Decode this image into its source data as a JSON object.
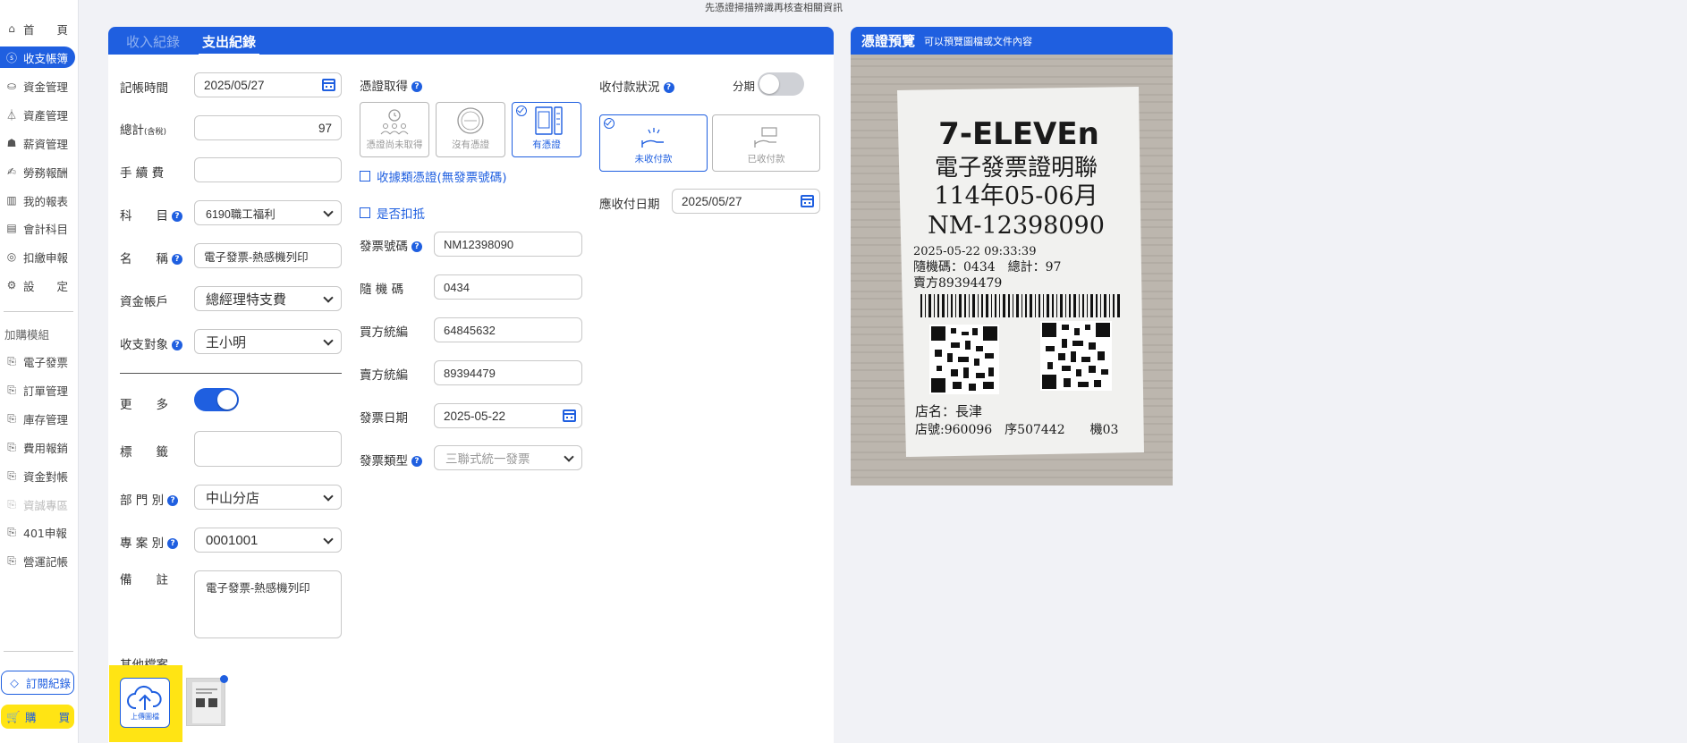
{
  "top_note": "先憑證掃描辨識再核查相關資訊",
  "sidebar": {
    "items": [
      {
        "label": "首　　頁",
        "icon": "home-icon",
        "glyph": "⌂"
      },
      {
        "label": "收支帳簿",
        "icon": "dollar-circle-icon",
        "glyph": "ⓢ"
      },
      {
        "label": "資金管理",
        "icon": "fund-icon",
        "glyph": "⛀"
      },
      {
        "label": "資產管理",
        "icon": "asset-icon",
        "glyph": "⏃"
      },
      {
        "label": "薪資管理",
        "icon": "payroll-icon",
        "glyph": "☗"
      },
      {
        "label": "勞務報酬",
        "icon": "service-fee-icon",
        "glyph": "✍"
      },
      {
        "label": "我的報表",
        "icon": "report-icon",
        "glyph": "▥"
      },
      {
        "label": "會計科目",
        "icon": "ledger-icon",
        "glyph": "▤"
      },
      {
        "label": "扣繳申報",
        "icon": "withholding-icon",
        "glyph": "◎"
      },
      {
        "label": "設　　定",
        "icon": "settings-icon",
        "glyph": "⚙"
      }
    ],
    "addon_section": "加購模組",
    "addons": [
      {
        "label": "電子發票",
        "icon": "module-icon",
        "glyph": "⎘",
        "disabled": false
      },
      {
        "label": "訂單管理",
        "icon": "module-icon",
        "glyph": "⎘",
        "disabled": false
      },
      {
        "label": "庫存管理",
        "icon": "module-icon",
        "glyph": "⎘",
        "disabled": false
      },
      {
        "label": "費用報銷",
        "icon": "module-icon",
        "glyph": "⎘",
        "disabled": false
      },
      {
        "label": "資金對帳",
        "icon": "module-icon",
        "glyph": "⎘",
        "disabled": false
      },
      {
        "label": "資誠專區",
        "icon": "module-icon",
        "glyph": "⎘",
        "disabled": true
      },
      {
        "label": "401申報",
        "icon": "module-icon",
        "glyph": "⎘",
        "disabled": false
      },
      {
        "label": "營運記帳",
        "icon": "module-icon",
        "glyph": "⎘",
        "disabled": false
      }
    ],
    "subscription": "訂閱紀錄",
    "purchase": "購　　買"
  },
  "tabs": {
    "income": "收入紀錄",
    "expense": "支出紀錄"
  },
  "form": {
    "record_time": {
      "label": "記帳時間",
      "value": "2025/05/27"
    },
    "total": {
      "label": "總計",
      "label_small": "(含稅)",
      "value": "97"
    },
    "fee": {
      "label": "手 續 費",
      "value": ""
    },
    "subject": {
      "label": "科　　目",
      "value": "6190職工福利"
    },
    "name": {
      "label": "名　　稱",
      "value": "電子發票-熱感機列印"
    },
    "fund_account": {
      "label": "資金帳戶",
      "value": "總經理特支費"
    },
    "counterparty": {
      "label": "收支對象",
      "value": "王小明"
    },
    "more": {
      "label": "更　　多"
    },
    "tags": {
      "label": "標　　籤",
      "value": ""
    },
    "department": {
      "label": "部 門 別",
      "value": "中山分店"
    },
    "project": {
      "label": "專 案 別",
      "value": "0001001"
    },
    "note": {
      "label": "備　　註",
      "value": "電子發票-熱感機列印"
    },
    "other_files": "其他檔案",
    "upload": "上傳圖檔"
  },
  "voucher": {
    "label": "憑證取得",
    "options": [
      "憑證尚未取得",
      "沒有憑證",
      "有憑證"
    ],
    "receipt_check": "收據類憑證(無發票號碼)",
    "deduct_check": "是否扣抵",
    "invoice_no": {
      "label": "發票號碼",
      "value": "NM12398090"
    },
    "random_code": {
      "label": "隨 機 碼",
      "value": "0434"
    },
    "buyer_id": {
      "label": "買方統編",
      "value": "64845632"
    },
    "seller_id": {
      "label": "賣方統編",
      "value": "89394479"
    },
    "invoice_date": {
      "label": "發票日期",
      "value": "2025-05-22"
    },
    "invoice_type": {
      "label": "發票類型",
      "placeholder": "三聯式統一發票"
    }
  },
  "payment": {
    "label": "收付款狀況",
    "installment": "分期",
    "options": [
      "未收付款",
      "已收付款"
    ],
    "due_date": {
      "label": "應收付日期",
      "value": "2025/05/27"
    }
  },
  "preview": {
    "title": "憑證預覽",
    "subtitle": "可以預覽圖檔或文件內容",
    "receipt": {
      "brand": "7-ELEVEn",
      "line1": "電子發票證明聯",
      "line2": "114年05-06月",
      "line3": "NM-12398090",
      "line4": "2025-05-22 09:33:39",
      "line5": "隨機碼：0434　總計：97",
      "line6": "賣方89394479",
      "line7": "店名：長津",
      "line8": "店號:960096　序507442　　機03"
    }
  }
}
